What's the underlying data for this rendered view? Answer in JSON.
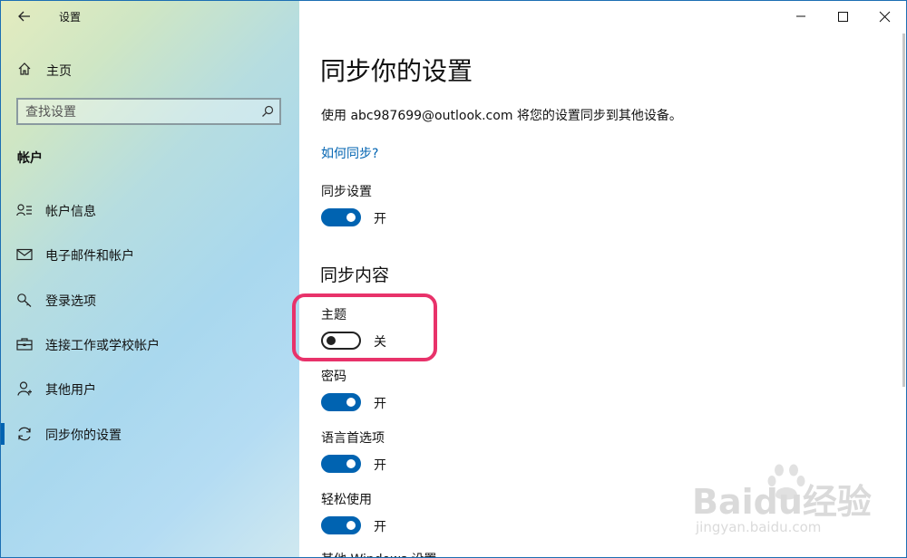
{
  "window": {
    "title": "设置"
  },
  "sidebar": {
    "home_label": "主页",
    "search_placeholder": "查找设置",
    "section_title": "帐户",
    "items": [
      {
        "label": "帐户信息",
        "icon": "account-info-icon"
      },
      {
        "label": "电子邮件和帐户",
        "icon": "mail-icon"
      },
      {
        "label": "登录选项",
        "icon": "key-icon"
      },
      {
        "label": "连接工作或学校帐户",
        "icon": "briefcase-icon"
      },
      {
        "label": "其他用户",
        "icon": "person-icon"
      },
      {
        "label": "同步你的设置",
        "icon": "sync-icon",
        "selected": true
      }
    ]
  },
  "main": {
    "title": "同步你的设置",
    "description": "使用 abc987699@outlook.com 将您的设置同步到其他设备。",
    "how_to_link": "如何同步?",
    "sync_settings": {
      "label": "同步设置",
      "state": "开",
      "on": true
    },
    "content_heading": "同步内容",
    "settings": [
      {
        "label": "主题",
        "state": "关",
        "on": false,
        "highlighted": true
      },
      {
        "label": "密码",
        "state": "开",
        "on": true
      },
      {
        "label": "语言首选项",
        "state": "开",
        "on": true
      },
      {
        "label": "轻松使用",
        "state": "开",
        "on": true
      },
      {
        "label": "其他 Windows 设置"
      }
    ]
  },
  "watermark": {
    "brand": "Baidu经验",
    "url": "jingyan.baidu.com"
  },
  "colors": {
    "accent": "#0063b1",
    "highlight": "#e8326a"
  }
}
